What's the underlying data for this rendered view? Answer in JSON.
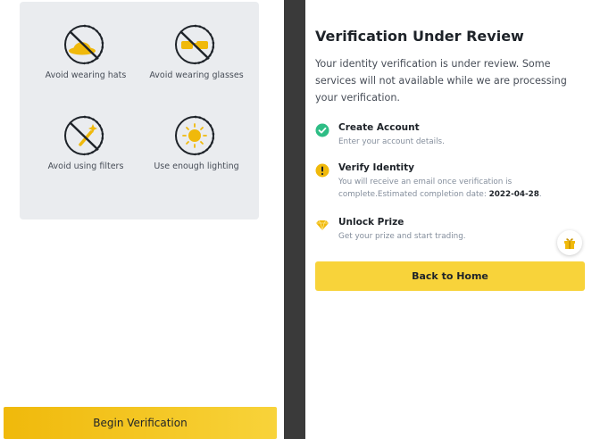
{
  "tips": [
    {
      "icon": "no-hat-icon",
      "label": "Avoid wearing hats"
    },
    {
      "icon": "no-glasses-icon",
      "label": "Avoid wearing glasses"
    },
    {
      "icon": "no-filter-icon",
      "label": "Avoid using filters"
    },
    {
      "icon": "lighting-icon",
      "label": "Use enough lighting"
    }
  ],
  "begin_button": "Begin Verification",
  "review": {
    "title": "Verification Under Review",
    "description": "Your identity verification is under review. Some services will not available while we are processing your verification.",
    "steps": [
      {
        "icon": "check-circle-icon",
        "name": "Create Account",
        "desc": "Enter your account details."
      },
      {
        "icon": "exclamation-circle-icon",
        "name": "Verify Identity",
        "desc": "You will receive an email once verification is complete.Estimated completion date: ",
        "date": "2022-04-28",
        "suffix": "."
      },
      {
        "icon": "prize-icon",
        "name": "Unlock Prize",
        "desc": "Get your prize and start trading."
      }
    ],
    "home_button": "Back to Home"
  },
  "colors": {
    "accent": "#f0b90b",
    "success": "#2ebd85",
    "panel": "#eaecef",
    "divider": "#3a3a3a"
  }
}
